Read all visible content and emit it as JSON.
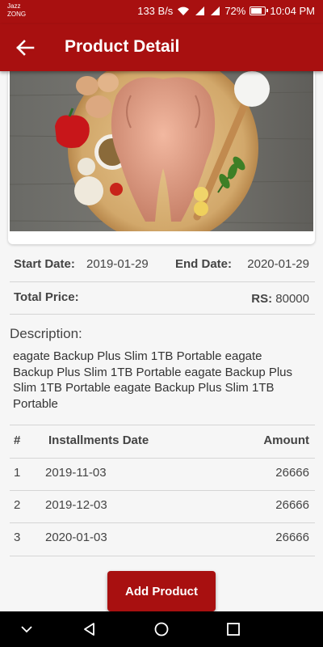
{
  "status_bar": {
    "carrier_line1": "Jazz",
    "carrier_line2": "ZONG",
    "speed": "133 B/s",
    "battery": "72%",
    "time": "10:04 PM",
    "icons": [
      "wifi-icon",
      "signal-icon",
      "signal-icon",
      "battery-icon"
    ]
  },
  "app_bar": {
    "title": "Product Detail",
    "back_icon": "arrow-left-icon",
    "color": "#a81010"
  },
  "dates": {
    "start_label": "Start Date:",
    "start_value": "2019-01-29",
    "end_label": "End Date:",
    "end_value": "2020-01-29"
  },
  "price": {
    "label": "Total Price:",
    "currency": "RS:",
    "value": "80000"
  },
  "description": {
    "title": "Description:",
    "text": "eagate Backup Plus Slim 1TB Portable  eagate Backup Plus Slim 1TB Portable eagate Backup Plus Slim 1TB Portable eagate Backup Plus Slim 1TB Portable"
  },
  "installments": {
    "headers": [
      "#",
      "Installments Date",
      "Amount"
    ],
    "rows": [
      {
        "num": "1",
        "date": "2019-11-03",
        "amount": "26666"
      },
      {
        "num": "2",
        "date": "2019-12-03",
        "amount": "26666"
      },
      {
        "num": "3",
        "date": "2020-01-03",
        "amount": "26666"
      }
    ]
  },
  "actions": {
    "add_product": "Add Product"
  },
  "nav_bar": {
    "icons": [
      "chevron-down-icon",
      "back-triangle-icon",
      "home-circle-icon",
      "recents-square-icon"
    ]
  }
}
